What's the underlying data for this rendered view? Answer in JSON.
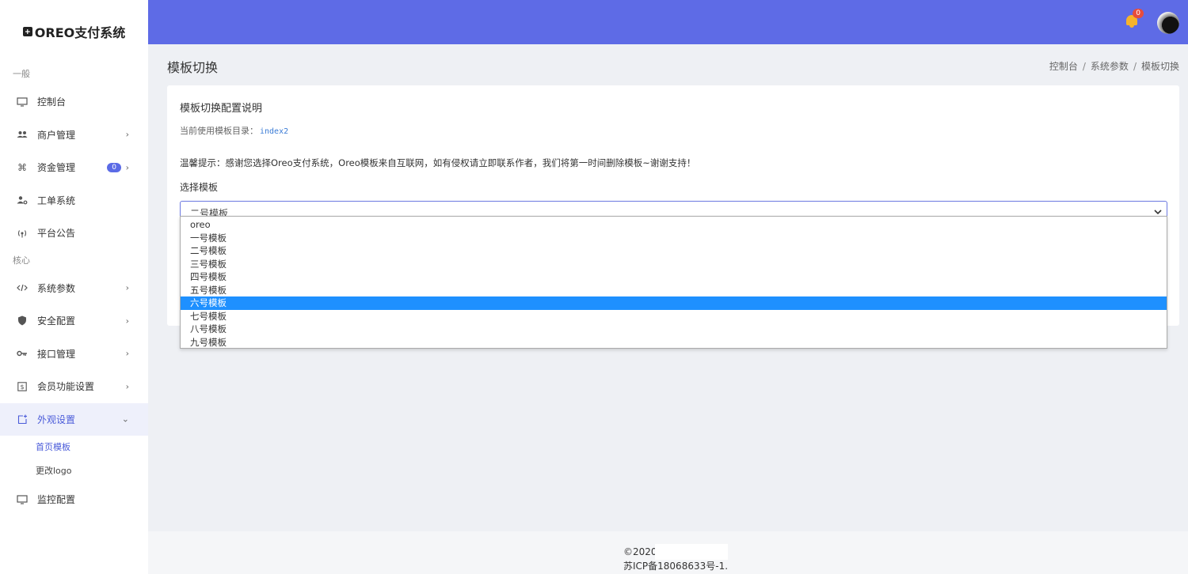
{
  "brand": {
    "name": "OREO支付系统"
  },
  "sidebar": {
    "group_general": "一般",
    "group_core": "核心",
    "items": [
      {
        "label": "控制台",
        "icon": "monitor-icon"
      },
      {
        "label": "商户管理",
        "icon": "users-icon"
      },
      {
        "label": "资金管理",
        "icon": "command-icon",
        "badge": "0"
      },
      {
        "label": "工单系统",
        "icon": "user-gear-icon"
      },
      {
        "label": "平台公告",
        "icon": "broadcast-icon"
      },
      {
        "label": "系统参数",
        "icon": "code-icon"
      },
      {
        "label": "安全配置",
        "icon": "shield-icon"
      },
      {
        "label": "接口管理",
        "icon": "key-icon"
      },
      {
        "label": "会员功能设置",
        "icon": "dollar-square-icon"
      },
      {
        "label": "外观设置",
        "icon": "edit-square-icon"
      },
      {
        "label": "监控配置",
        "icon": "monitor-icon"
      }
    ],
    "sub_items": [
      {
        "label": "首页模板"
      },
      {
        "label": "更改logo"
      }
    ]
  },
  "topbar": {
    "notification_count": "0"
  },
  "page": {
    "title": "模板切换",
    "breadcrumb": [
      "控制台",
      "系统参数",
      "模板切换"
    ],
    "separator": "/"
  },
  "card": {
    "title": "模板切换配置说明",
    "dir_label": "当前使用模板目录：",
    "dir_value": "index2",
    "tip": "温馨提示：感谢您选择Oreo支付系统，Oreo模板来自互联网，如有侵权请立即联系作者，我们将第一时间删除模板~谢谢支持！",
    "field_label": "选择模板",
    "selected_value": "二号模板",
    "options": [
      "oreo",
      "一号模板",
      "二号模板",
      "三号模板",
      "四号模板",
      "五号模板",
      "六号模板",
      "七号模板",
      "八号模板",
      "九号模板"
    ],
    "highlighted_index": 6
  },
  "footer": {
    "copyright": "©2020",
    "icp": "苏ICP备18068633号-1."
  }
}
